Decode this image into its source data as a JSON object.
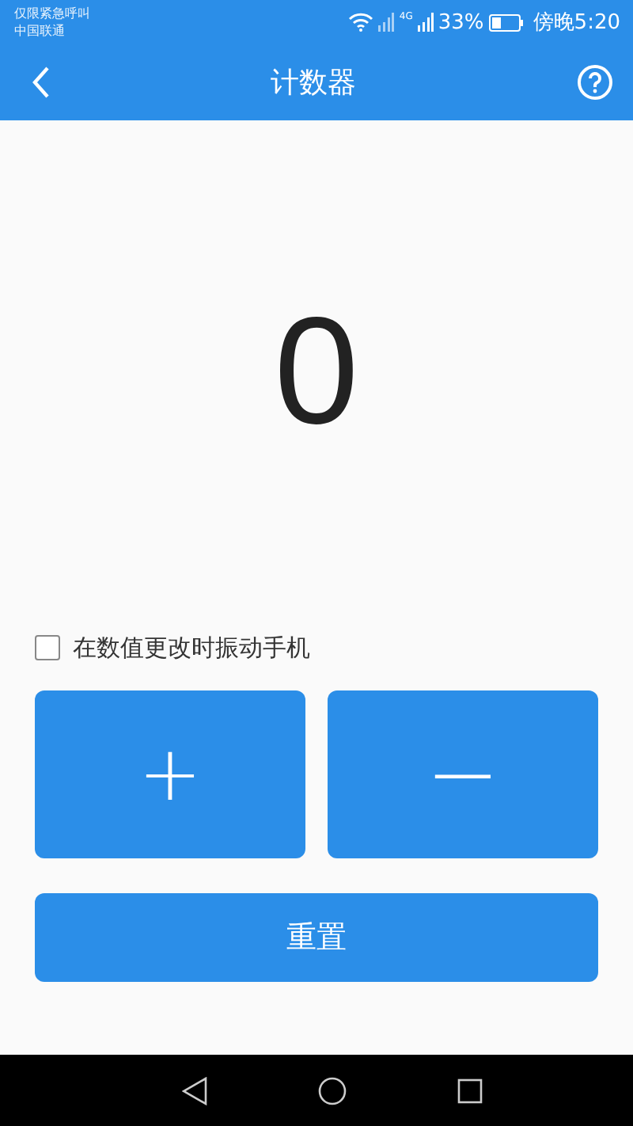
{
  "status_bar": {
    "notice": "仅限紧急呼叫",
    "carrier": "中国联通",
    "network": "4G",
    "battery": "33%",
    "time": "傍晚5:20"
  },
  "header": {
    "title": "计数器"
  },
  "counter": {
    "value": "0"
  },
  "vibrate_option": {
    "label": "在数值更改时振动手机",
    "checked": false
  },
  "buttons": [
    {
      "kind": "plus",
      "label": "+"
    },
    {
      "kind": "minus",
      "label": "−"
    }
  ],
  "reset_button": {
    "label": "重置"
  }
}
